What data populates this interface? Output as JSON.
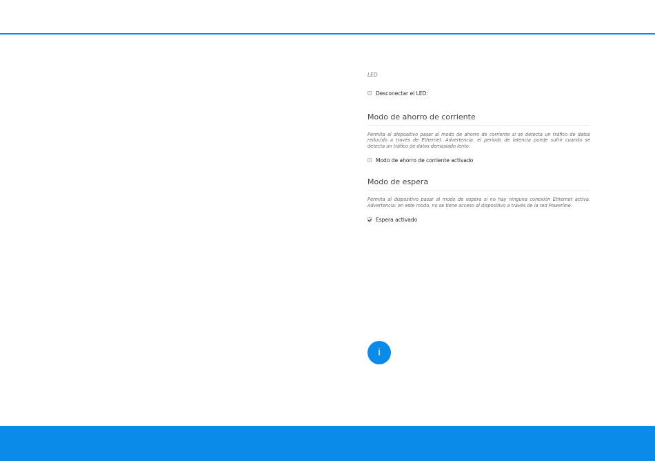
{
  "led": {
    "label": "LED",
    "disconnect_checkbox": {
      "label": "Desconectar el LED:",
      "checked": false
    }
  },
  "power_saving": {
    "title": "Modo de ahorro de corriente",
    "description": "Permita al dispositivo pasar al modo de ahorro de corriente si se detecta un tráfico de datos reducido a través de Ethernet. Advertencia: el período de latencia puede sufrir cuando se detecta un tráfico de datos demasiado lento.",
    "checkbox": {
      "label": "Modo de ahorro de corriente activado",
      "checked": false
    }
  },
  "standby": {
    "title": "Modo de espera",
    "description": "Permita al dispositivo pasar al modo de espera si no hay ninguna conexión Ethernet activa. Advertencia: en este modo, no se tiene acceso al dispositivo a través de la red Powerline.",
    "checkbox": {
      "label": "Espera activado",
      "checked": true
    }
  },
  "info_button": {
    "glyph": "i",
    "icon": "info-icon"
  },
  "colors": {
    "accent": "#0a8bea"
  }
}
